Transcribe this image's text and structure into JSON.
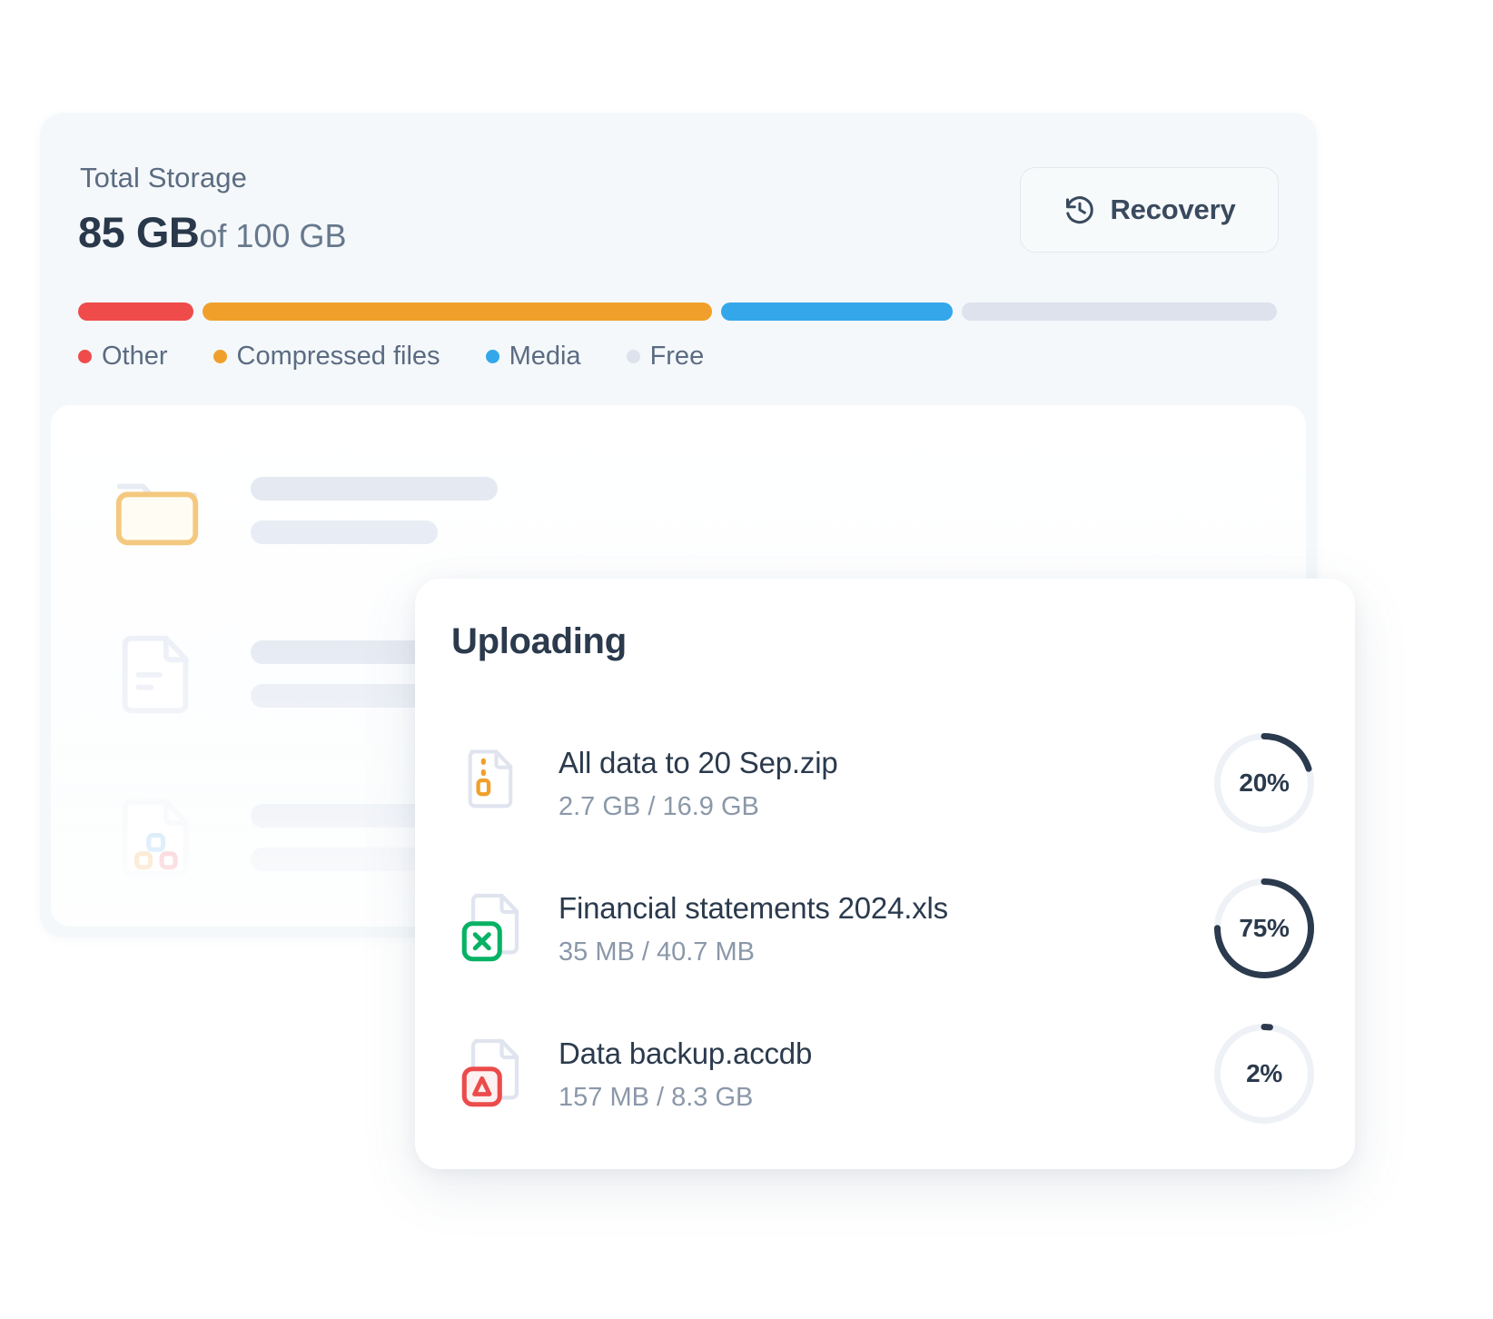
{
  "storage": {
    "title": "Total Storage",
    "used": "85 GB",
    "of_total": "of 100 GB",
    "recovery_label": "Recovery",
    "recovery_icon": "history-restore-icon",
    "segments": [
      {
        "name": "Other",
        "color": "#ef4b4b",
        "percent": 9.6
      },
      {
        "name": "Compressed files",
        "color": "#f0a02a",
        "percent": 42.6
      },
      {
        "name": "Media",
        "color": "#34a7eb",
        "percent": 19.4
      },
      {
        "name": "Free",
        "color": "#dde2ed",
        "percent": 26.3
      }
    ],
    "legend": [
      {
        "label": "Other",
        "color": "#ef4b4b"
      },
      {
        "label": "Compressed files",
        "color": "#f0a02a"
      },
      {
        "label": "Media",
        "color": "#34a7eb"
      },
      {
        "label": "Free",
        "color": "#dde2ed"
      }
    ]
  },
  "file_list_placeholder": {
    "rows": [
      {
        "icon": "folder-icon",
        "line1_width": 272,
        "line2_width": 206
      },
      {
        "icon": "document-icon",
        "line1_width": 310,
        "line2_width": 250
      },
      {
        "icon": "image-file-icon",
        "line1_width": 300,
        "line2_width": 240
      }
    ]
  },
  "uploading": {
    "title": "Uploading",
    "files": [
      {
        "icon": "zip-file-icon",
        "name": "All data to 20 Sep.zip",
        "size": "2.7 GB / 16.9 GB",
        "progress": 20,
        "progress_label": "20%"
      },
      {
        "icon": "excel-file-icon",
        "name": "Financial statements 2024.xls",
        "size": "35 MB / 40.7 MB",
        "progress": 75,
        "progress_label": "75%"
      },
      {
        "icon": "access-file-icon",
        "name": "Data backup.accdb",
        "size": "157 MB / 8.3 GB",
        "progress": 2,
        "progress_label": "2%"
      }
    ],
    "ring_track_color": "#eef1f6",
    "ring_fill_color": "#2b3a4d"
  }
}
